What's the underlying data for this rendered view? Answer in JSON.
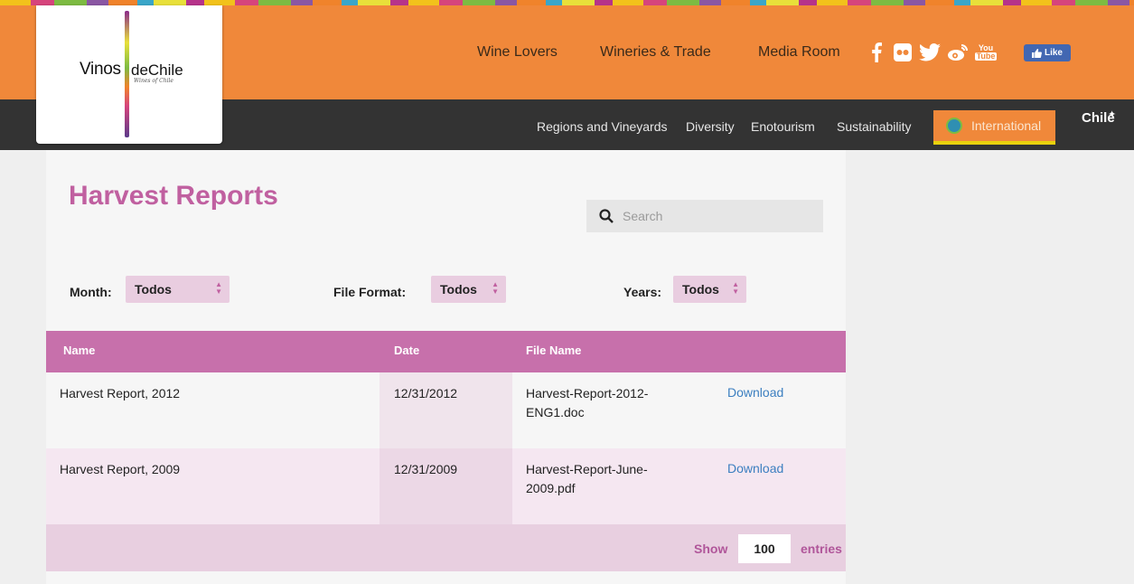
{
  "brand": {
    "logo_left": "Vinos",
    "logo_right": "deChile",
    "logo_tagline": "Wines of Chile"
  },
  "top_nav": {
    "items": [
      "Wine Lovers",
      "Wineries & Trade",
      "Media Room"
    ],
    "like_label": "Like",
    "youtube_top": "You",
    "youtube_bottom": "Tube"
  },
  "sub_nav": {
    "items": [
      "Regions and Vineyards",
      "Diversity",
      "Enotourism",
      "Sustainability"
    ],
    "international_label": "International",
    "chile_mark": "Chile"
  },
  "page": {
    "title": "Harvest Reports",
    "search_placeholder": "Search"
  },
  "filters": {
    "month_label": "Month:",
    "month_value": "Todos",
    "format_label": "File Format:",
    "format_value": "Todos",
    "years_label": "Years:",
    "years_value": "Todos"
  },
  "table": {
    "headers": [
      "Name",
      "Date",
      "File Name"
    ],
    "rows": [
      {
        "name": "Harvest Report, 2012",
        "date": "12/31/2012",
        "file_line1": "Harvest-Report-2012-",
        "file_line2": "ENG1.doc",
        "action": "Download"
      },
      {
        "name": "Harvest Report, 2009",
        "date": "12/31/2009",
        "file_line1": "Harvest-Report-June-",
        "file_line2": "2009.pdf",
        "action": "Download"
      }
    ]
  },
  "pagination": {
    "show_label": "Show",
    "entries_value": "100",
    "entries_label": "entries"
  },
  "colors": {
    "header_orange": "#f0883a",
    "nav_dark": "#333333",
    "accent_pink": "#c770ab",
    "title_pink": "#c060a0",
    "link_blue": "#3c7fc0"
  }
}
